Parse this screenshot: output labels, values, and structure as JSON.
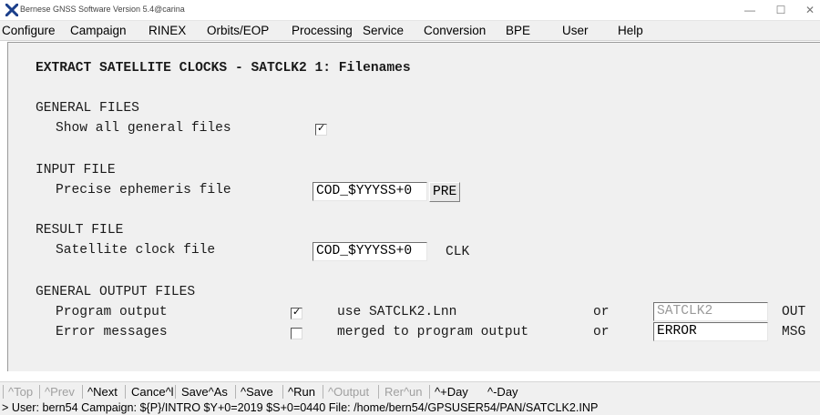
{
  "window": {
    "title": "Bernese GNSS Software Version 5.4@carina",
    "app_icon": "x-icon",
    "controls": [
      "minimize-icon",
      "maximize-icon",
      "close-icon"
    ]
  },
  "menu": [
    "Configure",
    "Campaign",
    "RINEX",
    "Orbits/EOP",
    "Processing",
    "Service",
    "Conversion",
    "BPE",
    "User",
    "Help"
  ],
  "panel": {
    "heading": "EXTRACT SATELLITE CLOCKS - SATCLK2 1: Filenames",
    "general_files": {
      "section": "GENERAL FILES",
      "show_all_label": "Show all general files",
      "show_all_checked": true
    },
    "input_file": {
      "section": "INPUT FILE",
      "ephemeris_label": "Precise ephemeris file",
      "ephemeris_value": "COD_$YYYSS+0",
      "ephemeris_ext": "PRE"
    },
    "result_file": {
      "section": "RESULT FILE",
      "clock_label": "Satellite clock file",
      "clock_value": "COD_$YYYSS+0",
      "clock_ext": "CLK"
    },
    "output_files": {
      "section": "GENERAL OUTPUT FILES",
      "program_output_label": "Program output",
      "program_output_checked": true,
      "program_output_option": "use SATCLK2.Lnn",
      "or1": "or",
      "program_output_value": "SATCLK2",
      "program_output_ext": "OUT",
      "error_label": "Error messages",
      "error_checked": false,
      "error_option": "merged to program output",
      "or2": "or",
      "error_value": "ERROR",
      "error_ext": "MSG"
    }
  },
  "toolbar": {
    "items": [
      {
        "label": "^Top",
        "enabled": false
      },
      {
        "label": "^Prev",
        "enabled": false
      },
      {
        "label": "^Next",
        "enabled": true
      },
      {
        "label": "Cance^l",
        "enabled": true
      },
      {
        "label": "Save^As",
        "enabled": true
      },
      {
        "label": "^Save",
        "enabled": true
      },
      {
        "label": "^Run",
        "enabled": true
      },
      {
        "label": "^Output",
        "enabled": false
      },
      {
        "label": "Rer^un",
        "enabled": false
      },
      {
        "label": "^+Day",
        "enabled": true
      },
      {
        "label": "^-Day",
        "enabled": true
      }
    ]
  },
  "status": "> User: bern54  Campaign: ${P}/INTRO  $Y+0=2019  $S+0=0440  File: /home/bern54/GPSUSER54/PAN/SATCLK2.INP"
}
